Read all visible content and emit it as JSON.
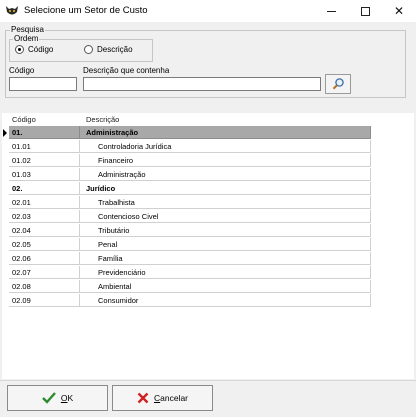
{
  "window": {
    "title": "Selecione um Setor de Custo"
  },
  "search": {
    "group_label": "Pesquisa",
    "order_label": "Ordem",
    "order_options": [
      {
        "label": "Código",
        "checked": true
      },
      {
        "label": "Descrição",
        "checked": false
      }
    ],
    "code_label": "Código",
    "code_value": "",
    "description_label": "Descrição que contenha",
    "description_value": ""
  },
  "grid": {
    "columns": [
      "Código",
      "Descrição"
    ],
    "rows": [
      {
        "code": "01.",
        "description": "Administração",
        "group": true,
        "selected": true
      },
      {
        "code": "01.01",
        "description": "Controladoria Jurídica",
        "group": false,
        "selected": false
      },
      {
        "code": "01.02",
        "description": "Financeiro",
        "group": false,
        "selected": false
      },
      {
        "code": "01.03",
        "description": "Administração",
        "group": false,
        "selected": false
      },
      {
        "code": "02.",
        "description": "Jurídico",
        "group": true,
        "selected": false
      },
      {
        "code": "02.01",
        "description": "Trabalhista",
        "group": false,
        "selected": false
      },
      {
        "code": "02.03",
        "description": "Contencioso Civel",
        "group": false,
        "selected": false
      },
      {
        "code": "02.04",
        "description": "Tributário",
        "group": false,
        "selected": false
      },
      {
        "code": "02.05",
        "description": "Penal",
        "group": false,
        "selected": false
      },
      {
        "code": "02.06",
        "description": "Família",
        "group": false,
        "selected": false
      },
      {
        "code": "02.07",
        "description": "Previdenciário",
        "group": false,
        "selected": false
      },
      {
        "code": "02.08",
        "description": "Ambiental",
        "group": false,
        "selected": false
      },
      {
        "code": "02.09",
        "description": "Consumidor",
        "group": false,
        "selected": false
      }
    ]
  },
  "buttons": {
    "ok_label": "OK",
    "cancel_label": "Cancelar"
  },
  "icons": {
    "app": "cat-app-icon",
    "search": "magnifier-icon",
    "ok": "green-check-icon",
    "cancel": "red-x-icon"
  },
  "colors": {
    "selected_row": "#a8a8a8",
    "ok_check": "#2e8b2e",
    "cancel_x": "#d02020"
  }
}
